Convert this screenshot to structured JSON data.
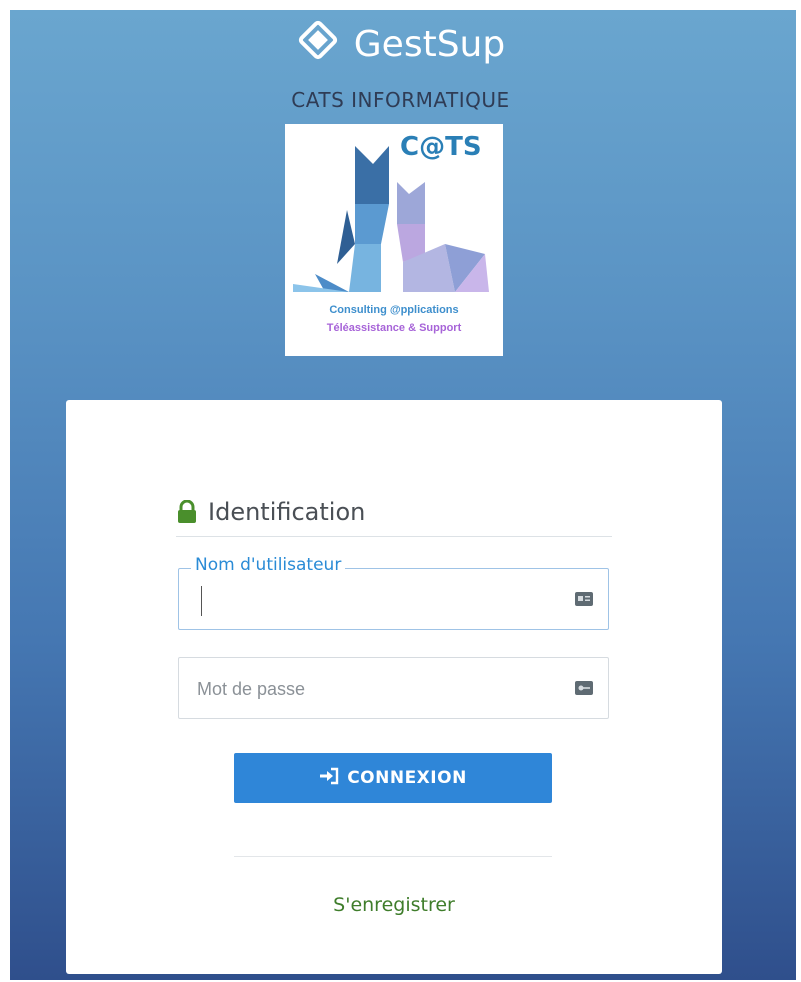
{
  "app": {
    "name": "GestSup",
    "company": "CATS INFORMATIQUE"
  },
  "logo": {
    "title": "C@TS",
    "line1": "Consulting @pplications",
    "line2": "Téléassistance & Support"
  },
  "login": {
    "heading": "Identification",
    "username": {
      "label": "Nom d'utilisateur",
      "value": "",
      "icon": "id-card-icon"
    },
    "password": {
      "placeholder": "Mot de passe",
      "value": "",
      "icon": "key-icon"
    },
    "submit_label": "CONNEXION",
    "submit_icon": "sign-in-icon",
    "register_label": "S'enregistrer"
  },
  "colors": {
    "primary": "#2f86d8",
    "success_lock": "#4a8f2c",
    "link": "#3f7d2b",
    "focus_label": "#2a8bd6"
  }
}
